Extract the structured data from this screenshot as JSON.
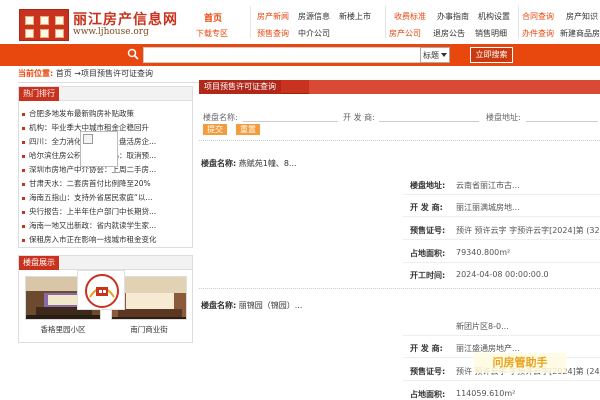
{
  "header": {
    "site_title": "丽江房产信息网",
    "site_url": "www.ljhouse.org",
    "nav": {
      "home": "首页",
      "download": "下载专区",
      "new_homes": "房产新闻",
      "presale": "预售查询",
      "info": "房源信息",
      "agency": "中介公司",
      "new_launch": "新楼上市",
      "fee": "收费标准",
      "housing_company": "房产公司",
      "office_guide": "办事指南",
      "refund_notice": "退房公告",
      "org_setup": "机构设置",
      "sales_list": "销售明细",
      "contract_query": "合同查询",
      "office_query": "办件查询",
      "knowledge": "房产知识",
      "new_build": "新建商品房"
    }
  },
  "search": {
    "input_value": "",
    "select_value": "标题",
    "button_label": "立即搜索"
  },
  "breadcrumb": {
    "label": "当前位置:",
    "path": "首页 →项目预售许可证查询"
  },
  "hot": {
    "title": "热门排行",
    "items": [
      "合肥多地发布最新购房补贴政策",
      "机构：毕业季大中城市租金企稳回升",
      "四川：全力消化市场存量，盘活房企...",
      "哈尔滨住房公积金管理中心：取消预...",
      "深圳市房地产中介协会：上周二手房...",
      "甘肃天水：二套房首付比例降至20%",
      "海南五指山：支持外省居民家庭“以...",
      "央行报告：上半年住户部门中长期贷...",
      "海南一地又出新政：省内就读学生家...",
      "保租房入市正在影响一线城市租金变化"
    ]
  },
  "show": {
    "title": "楼盘展示",
    "cards": [
      {
        "caption": "香格里园小区"
      },
      {
        "caption": "南门商业街"
      }
    ]
  },
  "main": {
    "tab_title": "项目预售许可证查询",
    "form": {
      "name_label": "楼盘名称:",
      "developer_label": "开 发 商:",
      "address_label": "楼盘地址:",
      "submit_label": "提交",
      "reset_label": "重置"
    },
    "records": [
      {
        "name_label": "楼盘名称:",
        "name": "燕赋苑1幢、8...",
        "address_label": "楼盘地址:",
        "address": "云南省丽江市古...",
        "developer_label": "开 发 商:",
        "developer": "丽江丽满城房地...",
        "presale_label": "预售证号:",
        "presale": "预许 预许云字 字预许云字[2024]第 (329)",
        "area_label": "占地面积:",
        "area": "79340.800m²",
        "date_label": "开工时间:",
        "date": "2024-04-08 00:00:00.0"
      },
      {
        "name_label": "楼盘名称:",
        "name": "丽锦园（锦园）...",
        "address": "新团片区8-0...",
        "developer_label": "开 发 商:",
        "developer": "丽江盛通房地产...",
        "presale_label": "预售证号:",
        "presale": "预许 预许云字 字预许云字[2024]第 (248)",
        "area_label": "占地面积:",
        "area": "114059.610m²"
      }
    ],
    "logo_text": "还\n溪\n房\n产\n网",
    "logo_text_flat": "还溪房产网"
  },
  "watermark": "问房管助手",
  "colors": {
    "brand_red": "#c8321e",
    "accent_orange": "#e8470e",
    "button_orange": "#f39c3e"
  }
}
